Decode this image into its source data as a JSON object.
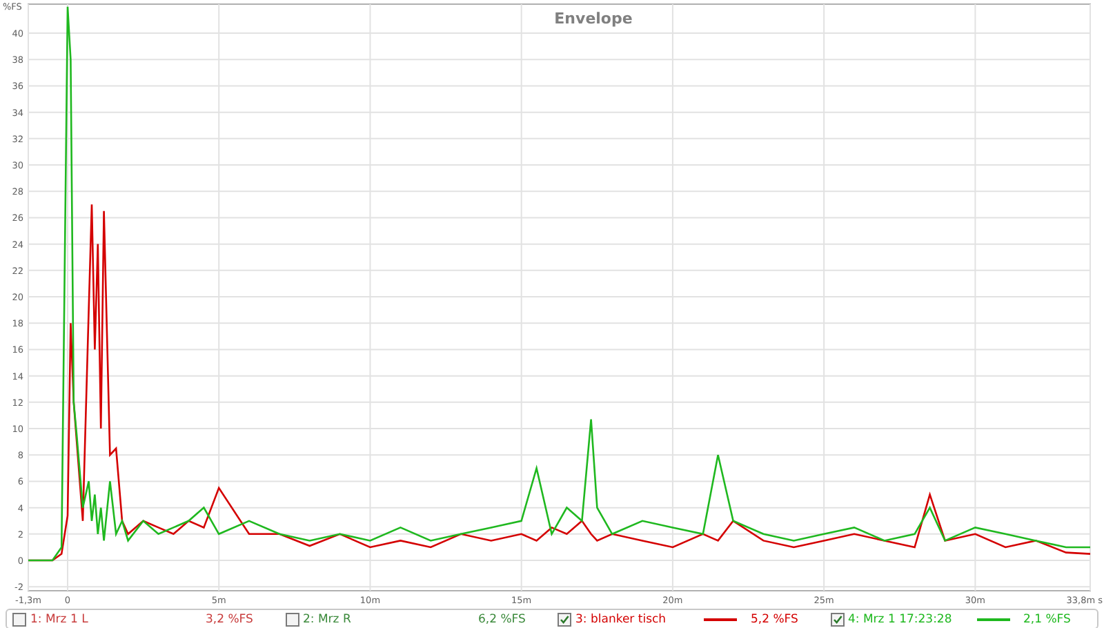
{
  "chart": {
    "chart_data": {
      "type": "line",
      "title": "Envelope",
      "ylabel": "%FS",
      "x": [
        -1.3,
        -0.5,
        -0.2,
        0,
        0.1,
        0.2,
        0.3,
        0.5,
        0.7,
        0.8,
        0.9,
        1.0,
        1.1,
        1.2,
        1.4,
        1.6,
        1.8,
        2,
        2.5,
        3,
        3.5,
        4,
        4.5,
        5,
        6,
        7,
        8,
        9,
        10,
        11,
        12,
        13,
        14,
        15,
        15.5,
        16,
        16.5,
        17,
        17.3,
        17.5,
        18,
        19,
        20,
        21,
        21.5,
        22,
        23,
        24,
        25,
        26,
        27,
        28,
        28.5,
        29,
        30,
        31,
        32,
        33,
        33.8
      ],
      "series": [
        {
          "color": "#d40000",
          "values": [
            0,
            0,
            0.5,
            3.4,
            18,
            12,
            9,
            3,
            19,
            27,
            16,
            24,
            10,
            26.5,
            8,
            8.5,
            3,
            2,
            3,
            2.5,
            2,
            3,
            2.5,
            5.5,
            2,
            2,
            1.1,
            2,
            1,
            1.5,
            1,
            2,
            1.5,
            2,
            1.5,
            2.5,
            2,
            3,
            2,
            1.5,
            2,
            1.5,
            1,
            2,
            1.5,
            3,
            1.5,
            1,
            1.5,
            2,
            1.5,
            1,
            5,
            1.5,
            2,
            1,
            1.5,
            0.6,
            0.5
          ]
        },
        {
          "color": "#1fb81f",
          "values": [
            0,
            0,
            1,
            42,
            38,
            12,
            9.5,
            4,
            6,
            3,
            5,
            2,
            4,
            1.5,
            6,
            2,
            3,
            1.5,
            3,
            2,
            2.5,
            3,
            4,
            2,
            3,
            2,
            1.5,
            2,
            1.5,
            2.5,
            1.5,
            2,
            2.5,
            3,
            7,
            2,
            4,
            3,
            10.7,
            4,
            2,
            3,
            2.5,
            2,
            8,
            3,
            2,
            1.5,
            2,
            2.5,
            1.5,
            2,
            4,
            1.5,
            2.5,
            2,
            1.5,
            1,
            1
          ]
        }
      ],
      "grid": true,
      "xlim": [
        -1.3,
        33.8
      ],
      "ylim": [
        -2.3,
        42.2
      ],
      "xticks": [
        {
          "value": -1.3,
          "label": "-1,3m"
        },
        {
          "value": 0,
          "label": "0"
        },
        {
          "value": 5,
          "label": "5m"
        },
        {
          "value": 10,
          "label": "10m"
        },
        {
          "value": 15,
          "label": "15m"
        },
        {
          "value": 20,
          "label": "20m"
        },
        {
          "value": 25,
          "label": "25m"
        },
        {
          "value": 30,
          "label": "30m"
        },
        {
          "value": 33.8,
          "label": "33,8m s"
        }
      ],
      "yticks": [
        -2,
        0,
        2,
        4,
        6,
        8,
        10,
        12,
        14,
        16,
        18,
        20,
        22,
        24,
        26,
        28,
        30,
        32,
        34,
        36,
        38,
        40
      ]
    }
  },
  "legend": [
    {
      "label": "1: Mrz 1 L",
      "checked": false,
      "color": "#c83c3c",
      "reading": "3,2 %FS"
    },
    {
      "label": "2: Mrz R",
      "checked": false,
      "color": "#3c8a3c",
      "reading": "6,2 %FS"
    },
    {
      "label": "3: blanker tisch",
      "checked": true,
      "color": "#d40000",
      "reading": "5,2 %FS"
    },
    {
      "label": "4: Mrz 1 17:23:28",
      "checked": true,
      "color": "#1fb81f",
      "reading": "2,1 %FS"
    }
  ]
}
